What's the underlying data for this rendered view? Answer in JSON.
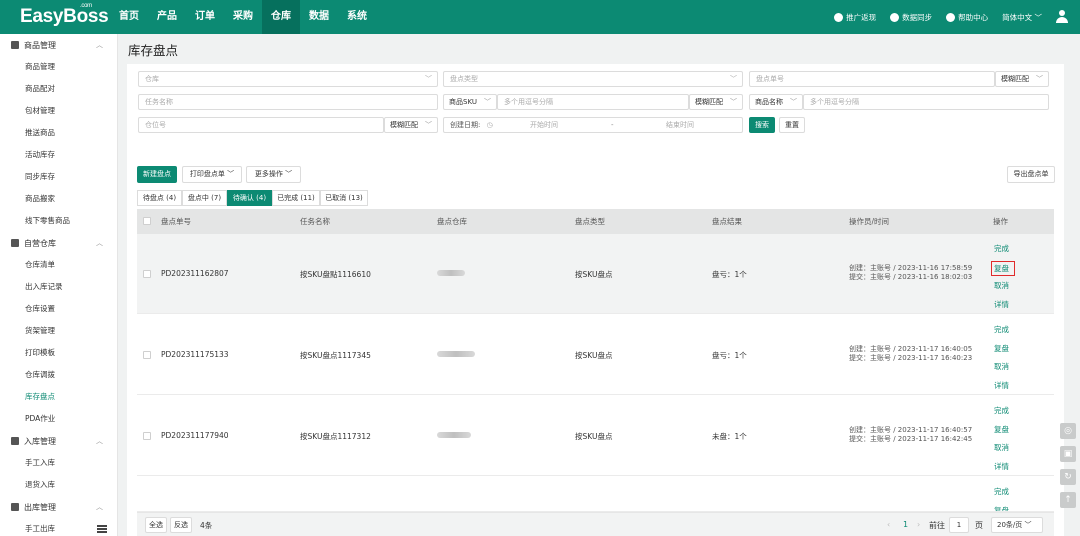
{
  "topbar": {
    "logo": "EasyBoss",
    "logo_sup": ".com",
    "nav": [
      "首页",
      "产品",
      "订单",
      "采购",
      "仓库",
      "数据",
      "系统"
    ],
    "active_nav": "仓库",
    "links": [
      "推广返现",
      "数据同步",
      "帮助中心"
    ],
    "language": "简体中文",
    "accent": "#0c8a73"
  },
  "sidebar": {
    "groups": [
      {
        "label": "商品管理",
        "items": [
          "商品管理",
          "商品配对",
          "包材管理",
          "推送商品",
          "活动库存",
          "同步库存",
          "商品搬家",
          "线下零售商品"
        ]
      },
      {
        "label": "自营仓库",
        "items": [
          "仓库清单",
          "出入库记录",
          "仓库设置",
          "货架管理",
          "打印模板",
          "仓库调拨",
          "库存盘点",
          "PDA作业"
        ]
      },
      {
        "label": "入库管理",
        "items": [
          "手工入库",
          "退货入库"
        ]
      },
      {
        "label": "出库管理",
        "items": [
          "手工出库"
        ]
      }
    ],
    "active_item": "库存盘点"
  },
  "page": {
    "title": "库存盘点"
  },
  "filters": {
    "warehouse_placeholder": "仓库",
    "type_placeholder": "盘点类型",
    "order_no_placeholder": "盘点单号",
    "fuzzy_label": "模糊匹配",
    "task_name_placeholder": "任务名称",
    "sku_select": "商品SKU",
    "multi_placeholder": "多个用逗号分隔",
    "product_name_select": "商品名称",
    "location_placeholder": "仓位号",
    "date_label": "创建日期:",
    "start_placeholder": "开始时间",
    "date_sep": "-",
    "end_placeholder": "结束时间",
    "search_button": "搜索",
    "reset_button": "重置"
  },
  "toolbar": {
    "new_button": "新建盘点",
    "print_button": "打印盘点单",
    "more_button": "更多操作",
    "export_button": "导出盘点单"
  },
  "tabs": [
    {
      "label": "待盘点 (4)",
      "active": false
    },
    {
      "label": "盘点中 (7)",
      "active": false
    },
    {
      "label": "待确认 (4)",
      "active": true
    },
    {
      "label": "已完成 (11)",
      "active": false
    },
    {
      "label": "已取消 (13)",
      "active": false
    }
  ],
  "table": {
    "headers": [
      "盘点单号",
      "任务名称",
      "盘点仓库",
      "盘点类型",
      "盘点结果",
      "操作员/时间",
      "操作"
    ],
    "rows": [
      {
        "order_no": "PD202311162807",
        "task": "按SKU盘點1116610",
        "type": "按SKU盘点",
        "result": "盘亏：1个",
        "created": "创建：主账号 / 2023-11-16 17:58:59",
        "submitted": "提交：主账号 / 2023-11-16 18:02:03"
      },
      {
        "order_no": "PD202311175133",
        "task": "按SKU盘点1117345",
        "type": "按SKU盘点",
        "result": "盘亏：1个",
        "created": "创建：主账号 / 2023-11-17 16:40:05",
        "submitted": "提交：主账号 / 2023-11-17 16:40:23"
      },
      {
        "order_no": "PD202311177940",
        "task": "按SKU盘点1117312",
        "type": "按SKU盘点",
        "result": "未盘：1个",
        "created": "创建：主账号 / 2023-11-17 16:40:57",
        "submitted": "提交：主账号 / 2023-11-17 16:42:45"
      }
    ],
    "row_actions": [
      "完成",
      "复盘",
      "取消",
      "详情"
    ]
  },
  "footer": {
    "select_all": "全选",
    "invert": "反选",
    "count": "4条",
    "current_page": "1",
    "goto_label": "前往",
    "goto_value": "1",
    "page_unit": "页",
    "page_size": "20条/页"
  }
}
